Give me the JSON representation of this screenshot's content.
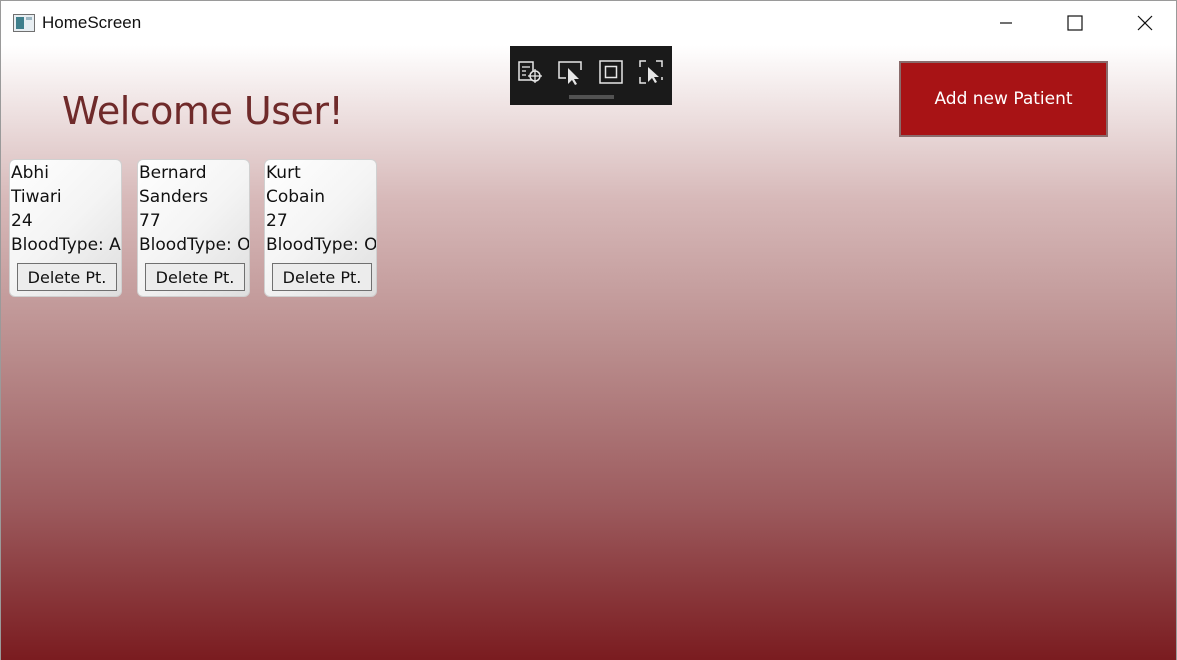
{
  "window": {
    "title": "HomeScreen",
    "controls": [
      "minimize",
      "maximize",
      "close"
    ]
  },
  "header": {
    "welcome": "Welcome User!",
    "add_button": "Add new Patient"
  },
  "dev_toolbar": {
    "icons": [
      "live-visual-tree-icon",
      "select-element-icon",
      "display-layout-adorners-icon",
      "track-focused-element-icon"
    ]
  },
  "patients": [
    {
      "first": "Abhi",
      "last": "Tiwari",
      "age": "24",
      "blood": "BloodType: A+",
      "delete_label": "Delete Pt."
    },
    {
      "first": "Bernard",
      "last": "Sanders",
      "age": "77",
      "blood": "BloodType: O+",
      "delete_label": "Delete Pt."
    },
    {
      "first": "Kurt",
      "last": "Cobain",
      "age": "27",
      "blood": "BloodType: O-",
      "delete_label": "Delete Pt."
    }
  ],
  "colors": {
    "accent_button": "#a81315",
    "welcome_text": "#6f2a2a",
    "gradient_bottom": "#7a1b1f"
  }
}
